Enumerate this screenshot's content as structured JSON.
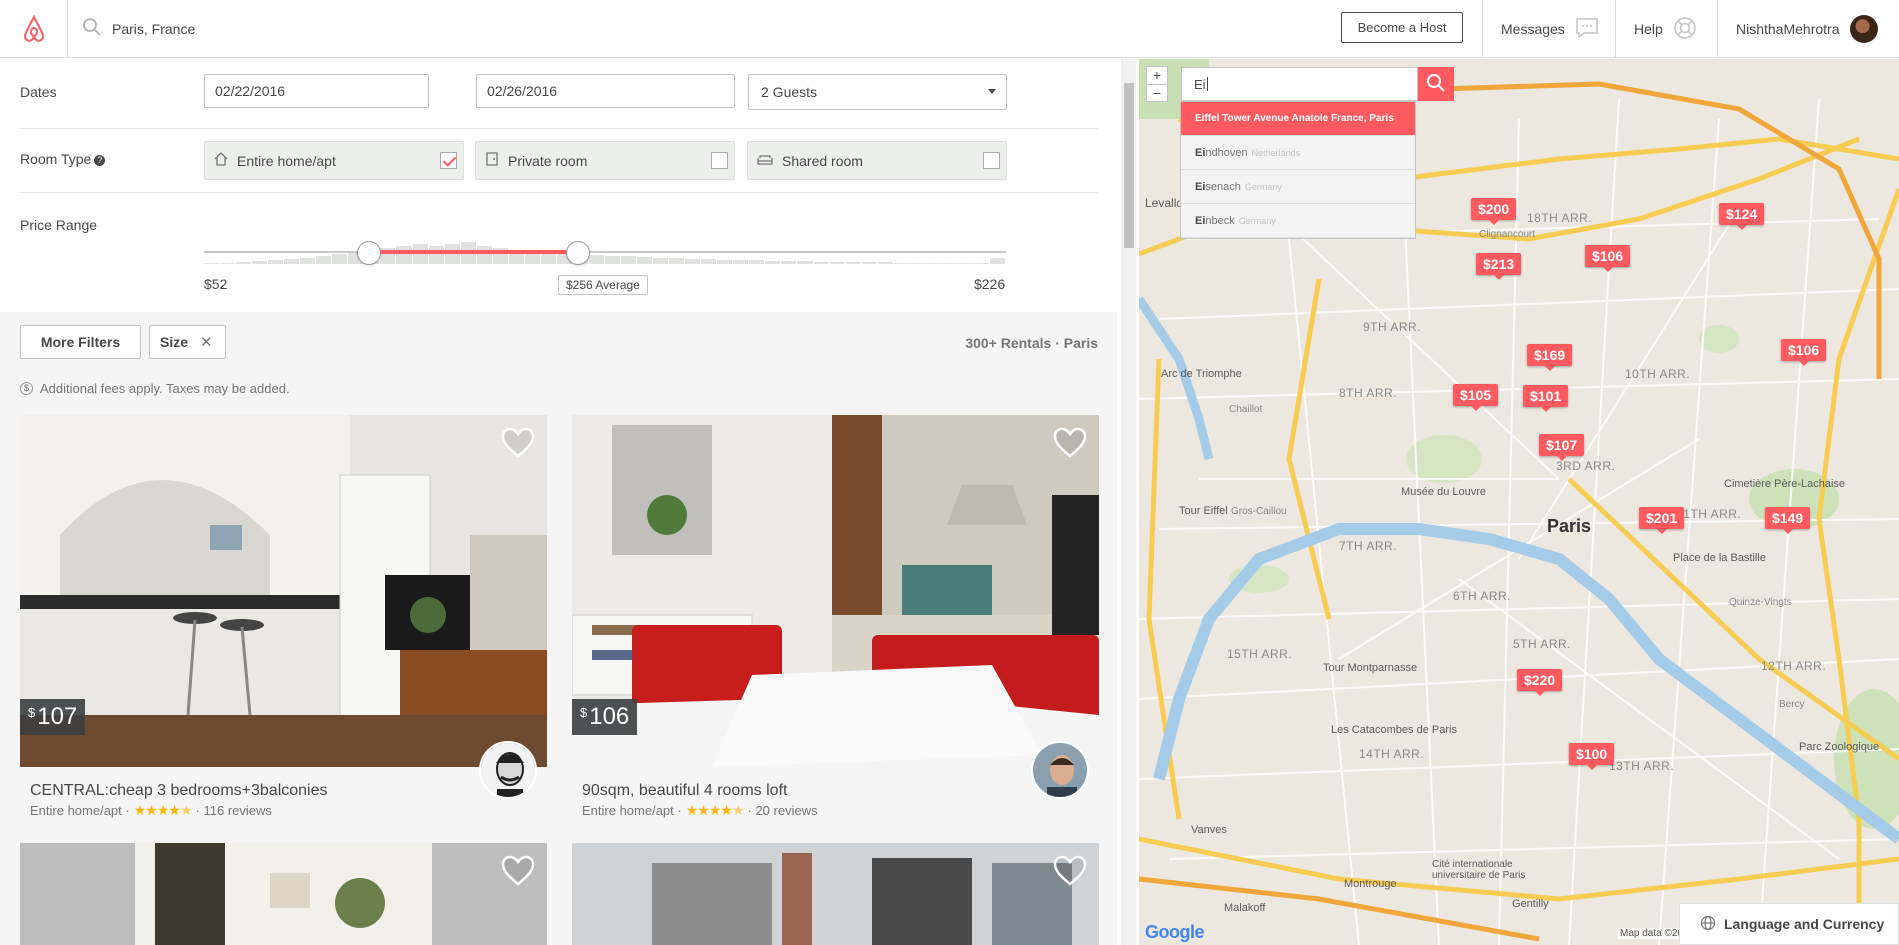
{
  "header": {
    "search_value": "Paris, France",
    "become_host": "Become a Host",
    "messages": "Messages",
    "help": "Help",
    "user_name": "NishthaMehrotra"
  },
  "filters": {
    "dates_label": "Dates",
    "checkin": "02/22/2016",
    "checkout": "02/26/2016",
    "guests": "2 Guests",
    "room_type_label": "Room Type",
    "room_types": [
      {
        "label": "Entire home/apt",
        "checked": true
      },
      {
        "label": "Private room",
        "checked": false
      },
      {
        "label": "Shared room",
        "checked": false
      }
    ],
    "price_range_label": "Price Range",
    "price_min": "$52",
    "price_avg": "$256 Average",
    "price_max": "$226",
    "more_filters": "More Filters",
    "size_chip": "Size"
  },
  "results": {
    "count": "300+ Rentals · Paris",
    "fees_note": "Additional fees apply. Taxes may be added."
  },
  "listings": [
    {
      "currency": "$",
      "price": "107",
      "title": "CENTRAL:cheap 3 bedrooms+3balconies",
      "room_type": "Entire home/apt",
      "rating": 4.5,
      "reviews": "116 reviews"
    },
    {
      "currency": "$",
      "price": "106",
      "title": "90sqm, beautiful 4 rooms loft",
      "room_type": "Entire home/apt",
      "rating": 4.5,
      "reviews": "20 reviews"
    }
  ],
  "map": {
    "search_text": "Ei",
    "suggestions": [
      {
        "bold": "Ei",
        "rest": "ffel Tower Avenue Anatole France, Paris",
        "country": ""
      },
      {
        "bold": "Ei",
        "rest": "ndhoven",
        "country": "Netherlands"
      },
      {
        "bold": "Ei",
        "rest": "senach",
        "country": "Germany"
      },
      {
        "bold": "Ei",
        "rest": "nbeck",
        "country": "Germany"
      }
    ],
    "pins": [
      "$200",
      "$124",
      "$213",
      "$106",
      "$169",
      "$106",
      "$105",
      "$101",
      "$107",
      "$201",
      "$149",
      "$220",
      "$100"
    ],
    "places": [
      "Paris",
      "Arc de Triomphe",
      "Musée du Louvre",
      "Tour Eiffel",
      "Place de la Bastille",
      "Tour Montparnasse",
      "Les Catacombes de Paris",
      "Montrouge",
      "Gentilly",
      "Malakoff",
      "Vanves",
      "Cité internationale universitaire de Paris",
      "Cimetière Père-Lachaise",
      "Parc Zoologique",
      "Clignancourt",
      "Chaillot",
      "Gros-Caillou",
      "Bercy",
      "Quinze-Vingts",
      "Levallois"
    ],
    "arrondissements": [
      "18TH ARR.",
      "9TH ARR.",
      "8TH ARR.",
      "7TH ARR.",
      "6TH ARR.",
      "5TH ARR.",
      "3RD ARR.",
      "11TH ARR.",
      "12TH ARR.",
      "13TH ARR.",
      "14TH ARR.",
      "15TH ARR.",
      "10TH ARR."
    ],
    "google": "Google",
    "map_data": "Map data ©2016",
    "language_currency": "Language and Currency"
  }
}
